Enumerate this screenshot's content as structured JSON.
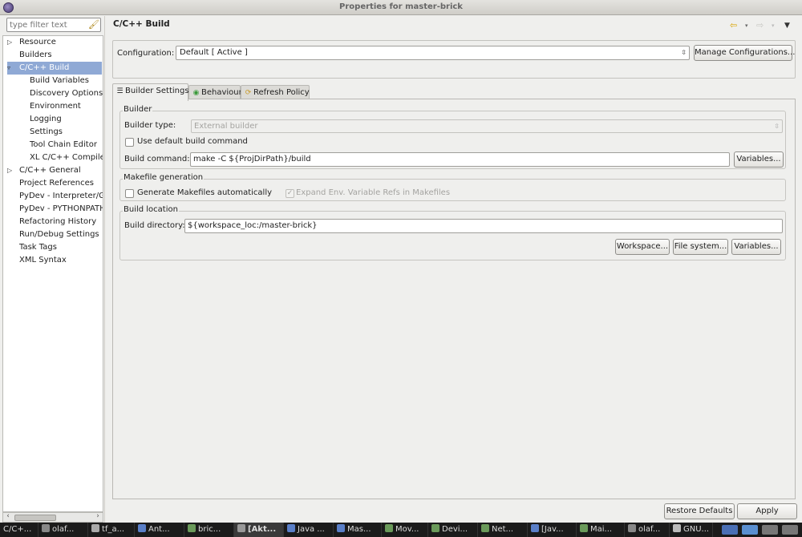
{
  "window": {
    "title": "Properties for master-brick"
  },
  "sidebar": {
    "filter_placeholder": "type filter text",
    "items": [
      {
        "label": "Resource",
        "level": 0,
        "expandable": true
      },
      {
        "label": "Builders",
        "level": 0,
        "expandable": false
      },
      {
        "label": "C/C++ Build",
        "level": 0,
        "expandable": true,
        "expanded": true,
        "selected": true
      },
      {
        "label": "Build Variables",
        "level": 1
      },
      {
        "label": "Discovery Options",
        "level": 1
      },
      {
        "label": "Environment",
        "level": 1
      },
      {
        "label": "Logging",
        "level": 1
      },
      {
        "label": "Settings",
        "level": 1
      },
      {
        "label": "Tool Chain Editor",
        "level": 1
      },
      {
        "label": "XL C/C++ Compiler",
        "level": 1
      },
      {
        "label": "C/C++ General",
        "level": 0,
        "expandable": true
      },
      {
        "label": "Project References",
        "level": 0
      },
      {
        "label": "PyDev - Interpreter/G",
        "level": 0
      },
      {
        "label": "PyDev - PYTHONPATH",
        "level": 0
      },
      {
        "label": "Refactoring History",
        "level": 0
      },
      {
        "label": "Run/Debug Settings",
        "level": 0
      },
      {
        "label": "Task Tags",
        "level": 0
      },
      {
        "label": "XML Syntax",
        "level": 0
      }
    ]
  },
  "page": {
    "title": "C/C++ Build",
    "configuration_label": "Configuration:",
    "configuration_value": "Default  [ Active ]",
    "manage_button": "Manage Configurations...",
    "tabs": [
      {
        "label": "Builder Settings",
        "icon": "list-icon",
        "active": true
      },
      {
        "label": "Behaviour",
        "icon": "radio-icon",
        "active": false
      },
      {
        "label": "Refresh Policy",
        "icon": "refresh-icon",
        "active": false
      }
    ],
    "builder": {
      "group_title": "Builder",
      "type_label": "Builder type:",
      "type_value": "External builder",
      "use_default_label": "Use default build command",
      "use_default_checked": false,
      "command_label": "Build command:",
      "command_value": "make -C ${ProjDirPath}/build",
      "variables_button": "Variables..."
    },
    "makefile": {
      "group_title": "Makefile generation",
      "generate_label": "Generate Makefiles automatically",
      "generate_checked": false,
      "expand_label": "Expand Env. Variable Refs in Makefiles",
      "expand_checked": true
    },
    "location": {
      "group_title": "Build location",
      "directory_label": "Build directory:",
      "directory_value": "${workspace_loc:/master-brick}",
      "workspace_button": "Workspace...",
      "filesystem_button": "File system...",
      "variables_button": "Variables..."
    },
    "restore_button": "Restore Defaults",
    "apply_button": "Apply"
  },
  "taskbar": {
    "items": [
      "C/C+...",
      "olaf...",
      "tf_a...",
      "Ant...",
      "bric...",
      "[Akt...",
      "Java ...",
      "Mas...",
      "Mov...",
      "Devi...",
      "Net...",
      "[Jav...",
      "Mai...",
      "olaf...",
      "GNU..."
    ],
    "active_index": 5
  },
  "colors": {
    "selection": "#8fa9d5",
    "taskbar": "#1b1b1b",
    "background": "#efefed"
  }
}
